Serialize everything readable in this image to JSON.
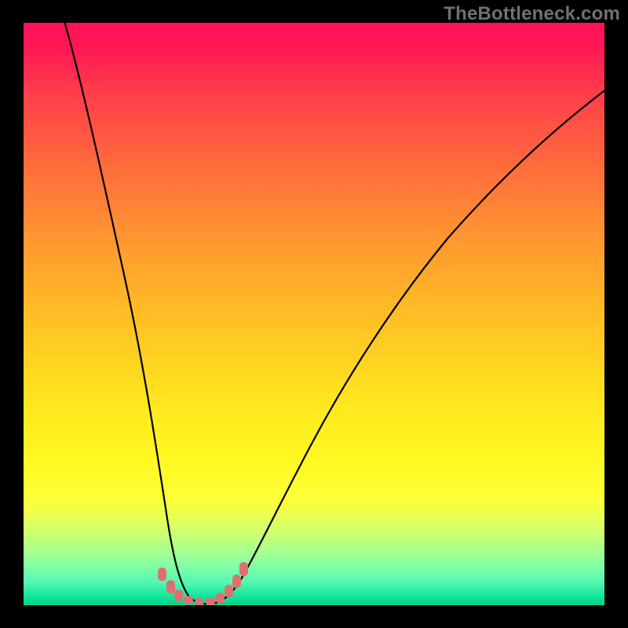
{
  "watermark": "TheBottleneck.com",
  "chart_data": {
    "type": "line",
    "title": "",
    "xlabel": "",
    "ylabel": "",
    "legend": false,
    "grid": false,
    "xlim": [
      0,
      100
    ],
    "ylim": [
      0,
      100
    ],
    "background": "rainbow-gradient (red top → green bottom)",
    "notes": "Curve estimated from pixels; axes are unlabeled so values are percent of plot extent (0,0 bottom-left).",
    "series": [
      {
        "name": "main-curve",
        "color": "#000000",
        "x": [
          7,
          9,
          11,
          13,
          15,
          17,
          19,
          21,
          23,
          24.5,
          26,
          28,
          30,
          32,
          35,
          38,
          42,
          46,
          50,
          55,
          60,
          66,
          72,
          78,
          85,
          92,
          99
        ],
        "y": [
          100,
          90,
          80,
          70,
          60,
          50,
          40,
          30,
          20,
          12,
          6,
          2,
          0.5,
          0.2,
          0.5,
          2.5,
          6,
          11,
          17,
          25,
          33,
          42,
          51,
          59,
          67,
          74,
          80
        ]
      }
    ],
    "markers": [
      {
        "name": "bottom-cluster",
        "color": "#e07070",
        "shape": "rounded-square",
        "x": [
          23.8,
          25.4,
          26.8,
          28.5,
          30.3,
          32.2,
          33.8,
          35.3,
          36.6,
          37.7
        ],
        "y": [
          4.8,
          2.6,
          1.3,
          0.55,
          0.25,
          0.3,
          0.9,
          2.0,
          3.6,
          5.6
        ]
      }
    ]
  },
  "colors": {
    "page_bg": "#000000",
    "curve": "#000000",
    "markers": "#e07070",
    "watermark": "#717171"
  }
}
